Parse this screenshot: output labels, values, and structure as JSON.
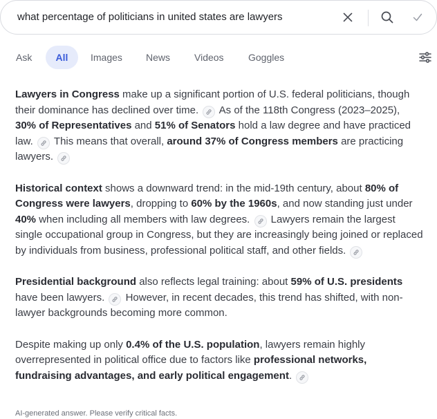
{
  "search": {
    "query": "what percentage of politicians in united states are lawyers"
  },
  "tabs": [
    {
      "label": "Ask",
      "active": false
    },
    {
      "label": "All",
      "active": true
    },
    {
      "label": "Images",
      "active": false
    },
    {
      "label": "News",
      "active": false
    },
    {
      "label": "Videos",
      "active": false
    },
    {
      "label": "Goggles",
      "active": false
    }
  ],
  "icons": {
    "clear": "close-icon",
    "search": "search-icon",
    "submit": "checkmark-icon",
    "filters": "sliders-icon",
    "citation": "link-icon"
  },
  "colors": {
    "accent": "#3a5bd9",
    "active_tab_bg": "#e6ebfb"
  },
  "answer": {
    "paragraphs": [
      [
        {
          "t": "Lawyers in Congress",
          "b": true
        },
        {
          "t": " make up a significant portion of U.S. federal politicians, though their dominance has declined over time. "
        },
        {
          "cite": true
        },
        {
          "t": " As of the 118th Congress (2023–2025), "
        },
        {
          "t": "30% of Representatives",
          "b": true
        },
        {
          "t": " and "
        },
        {
          "t": "51% of Senators",
          "b": true
        },
        {
          "t": " hold a law degree and have practiced law. "
        },
        {
          "cite": true
        },
        {
          "t": " This means that overall, "
        },
        {
          "t": "around 37% of Congress members",
          "b": true
        },
        {
          "t": " are practicing lawyers. "
        },
        {
          "cite": true
        }
      ],
      [
        {
          "t": "Historical context",
          "b": true
        },
        {
          "t": " shows a downward trend: in the mid-19th century, about "
        },
        {
          "t": "80% of Congress were lawyers",
          "b": true
        },
        {
          "t": ", dropping to "
        },
        {
          "t": "60% by the 1960s",
          "b": true
        },
        {
          "t": ", and now standing just under "
        },
        {
          "t": "40%",
          "b": true
        },
        {
          "t": " when including all members with law degrees. "
        },
        {
          "cite": true
        },
        {
          "t": " Lawyers remain the largest single occupational group in Congress, but they are increasingly being joined or replaced by individuals from business, professional political staff, and other fields. "
        },
        {
          "cite": true
        }
      ],
      [
        {
          "t": "Presidential background",
          "b": true
        },
        {
          "t": " also reflects legal training: about "
        },
        {
          "t": "59% of U.S. presidents",
          "b": true
        },
        {
          "t": " have been lawyers. "
        },
        {
          "cite": true
        },
        {
          "t": " However, in recent decades, this trend has shifted, with non-lawyer backgrounds becoming more common."
        }
      ],
      [
        {
          "t": "Despite making up only "
        },
        {
          "t": "0.4% of the U.S. population",
          "b": true
        },
        {
          "t": ", lawyers remain highly overrepresented in political office due to factors like "
        },
        {
          "t": "professional networks, fundraising advantages, and early political engagement",
          "b": true
        },
        {
          "t": ". "
        },
        {
          "cite": true
        }
      ]
    ],
    "disclaimer": "AI-generated answer. Please verify critical facts."
  }
}
